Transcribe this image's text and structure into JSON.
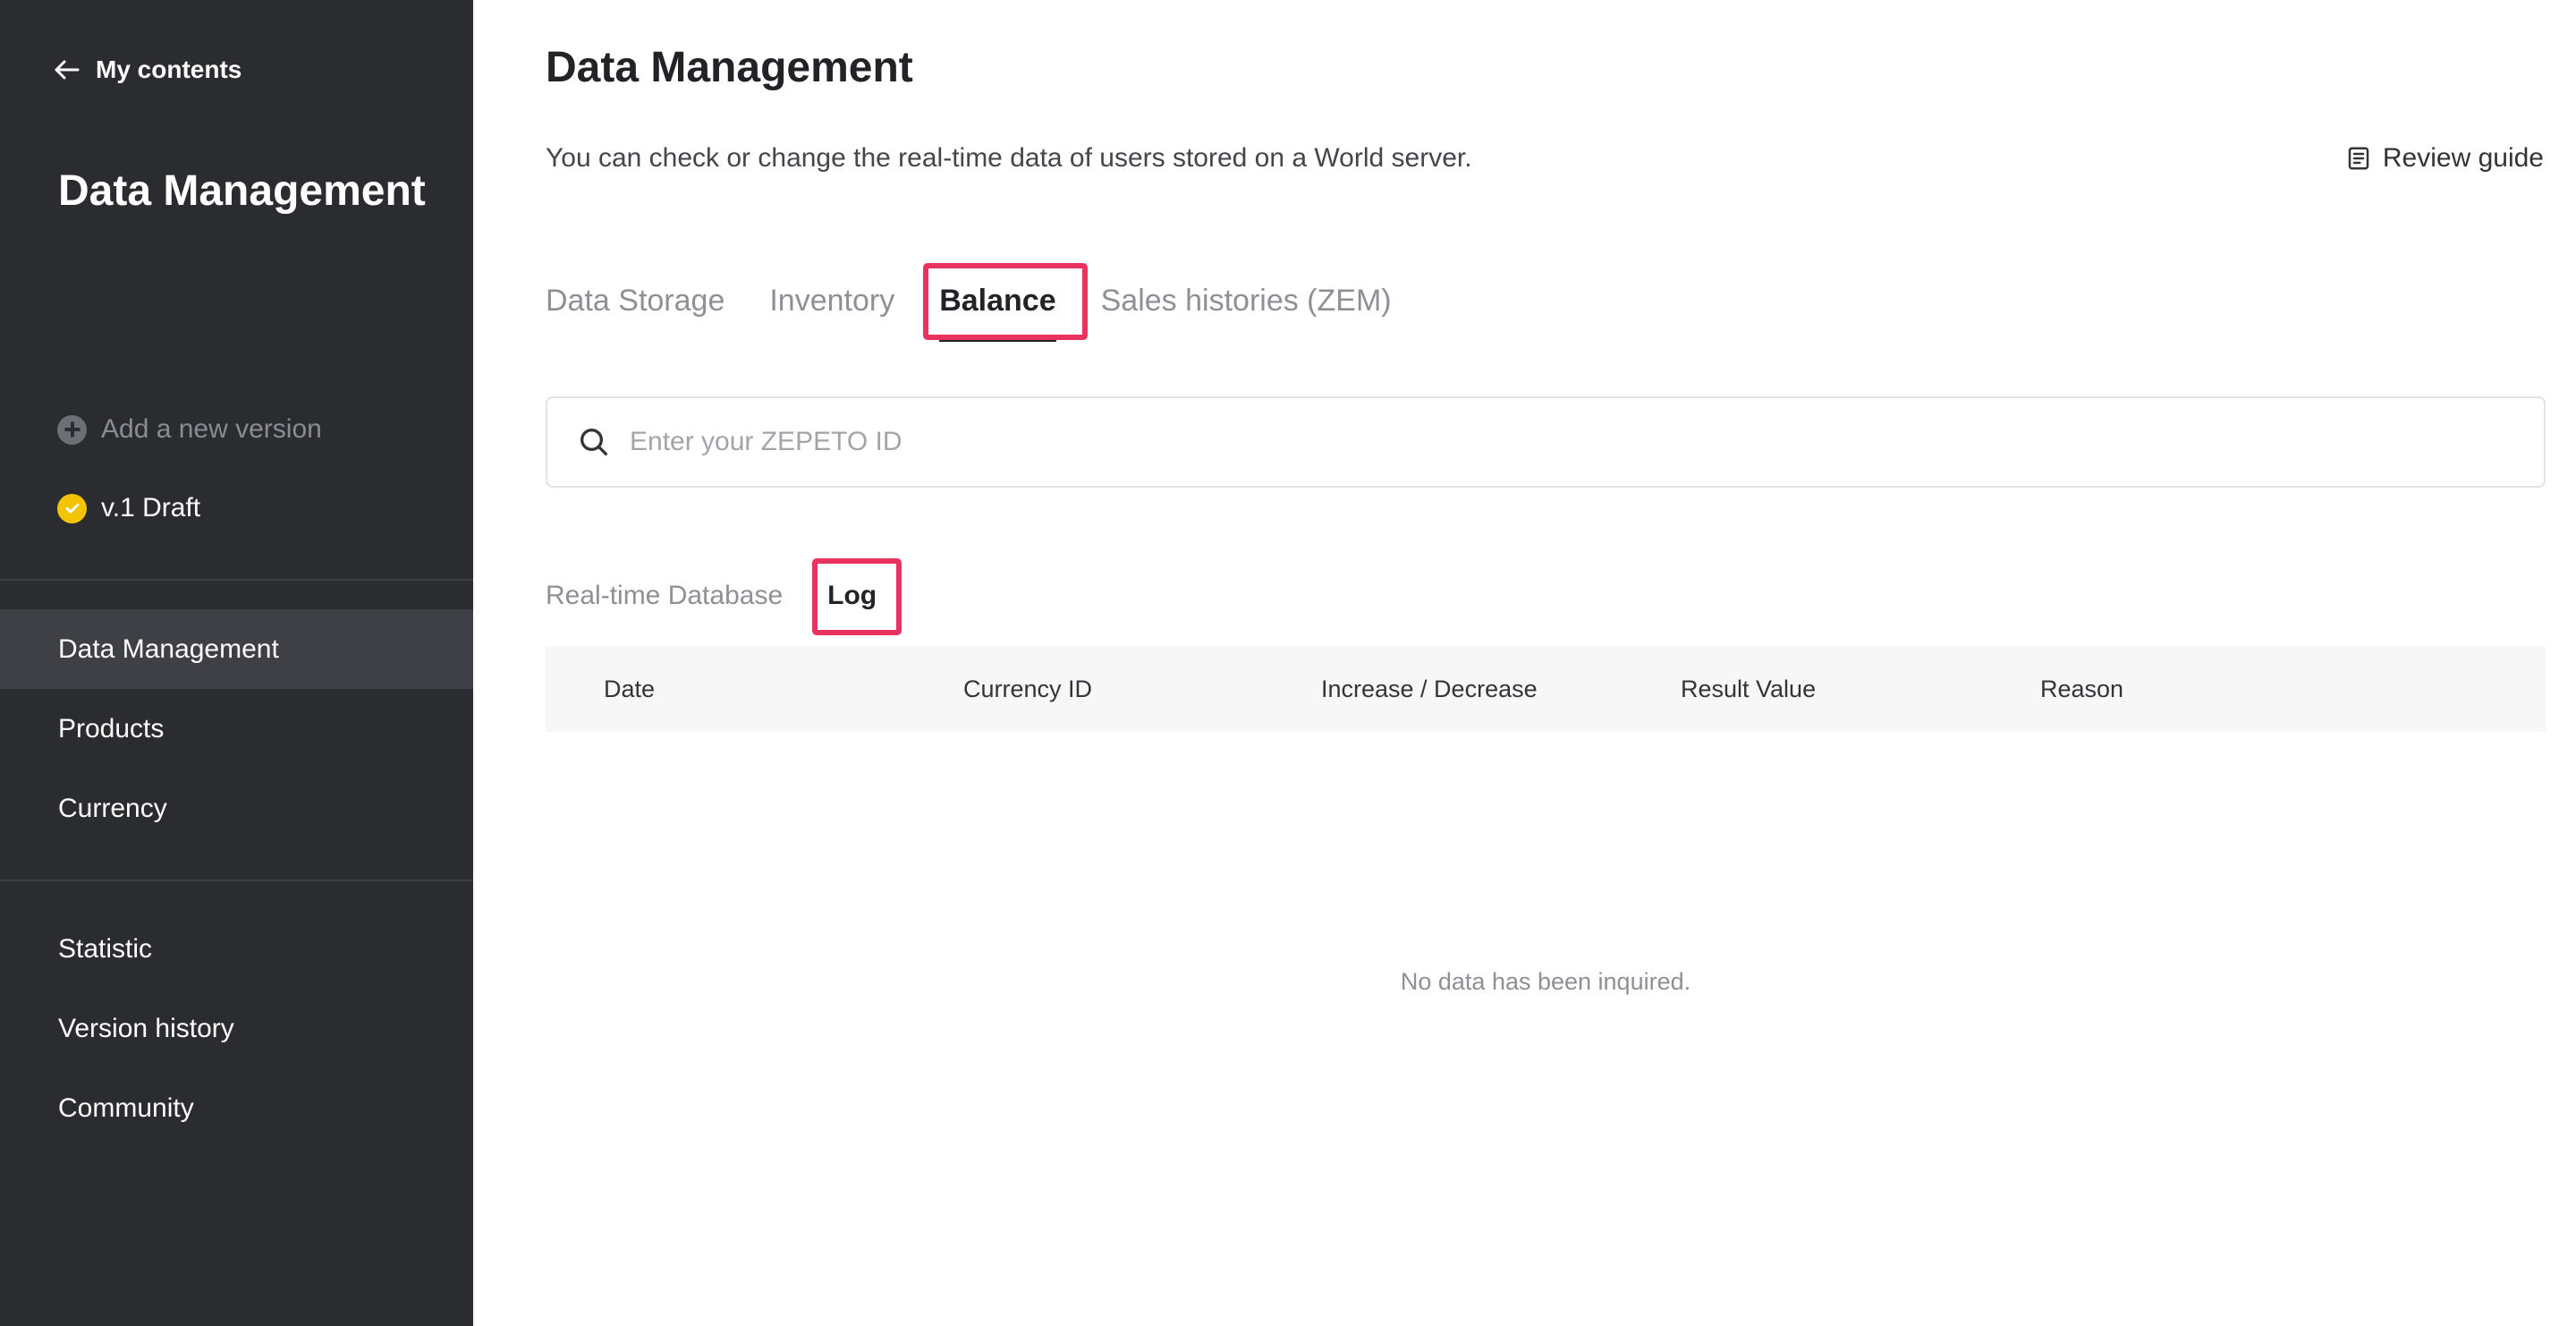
{
  "sidebar": {
    "back_label": "My contents",
    "title": "Data Management",
    "add_version_label": "Add a new version",
    "version_label": "v.1 Draft",
    "nav_group_1": [
      {
        "label": "Data Management",
        "active": true
      },
      {
        "label": "Products"
      },
      {
        "label": "Currency"
      }
    ],
    "nav_group_2": [
      {
        "label": "Statistic"
      },
      {
        "label": "Version history"
      },
      {
        "label": "Community"
      }
    ]
  },
  "header": {
    "title": "Data Management",
    "description": "You can check or change the real-time data of users stored on a World server.",
    "review_guide_label": "Review guide"
  },
  "tabs": [
    {
      "label": "Data Storage"
    },
    {
      "label": "Inventory"
    },
    {
      "label": "Balance",
      "active": true
    },
    {
      "label": "Sales histories (ZEM)"
    }
  ],
  "search": {
    "placeholder": "Enter your ZEPETO ID",
    "value": ""
  },
  "subtabs": [
    {
      "label": "Real-time Database"
    },
    {
      "label": "Log",
      "active": true
    }
  ],
  "table": {
    "columns": [
      "Date",
      "Currency ID",
      "Increase / Decrease",
      "Result Value",
      "Reason"
    ],
    "rows": [],
    "empty_message": "No data has been inquired."
  },
  "colors": {
    "sidebar_bg": "#2b2c30",
    "highlight": "#e8325f",
    "version_badge": "#f5c400"
  },
  "icons": {
    "back": "arrow-left-icon",
    "add": "plus-circle-icon",
    "version": "check-circle-icon",
    "guide": "document-icon",
    "search": "search-icon"
  }
}
